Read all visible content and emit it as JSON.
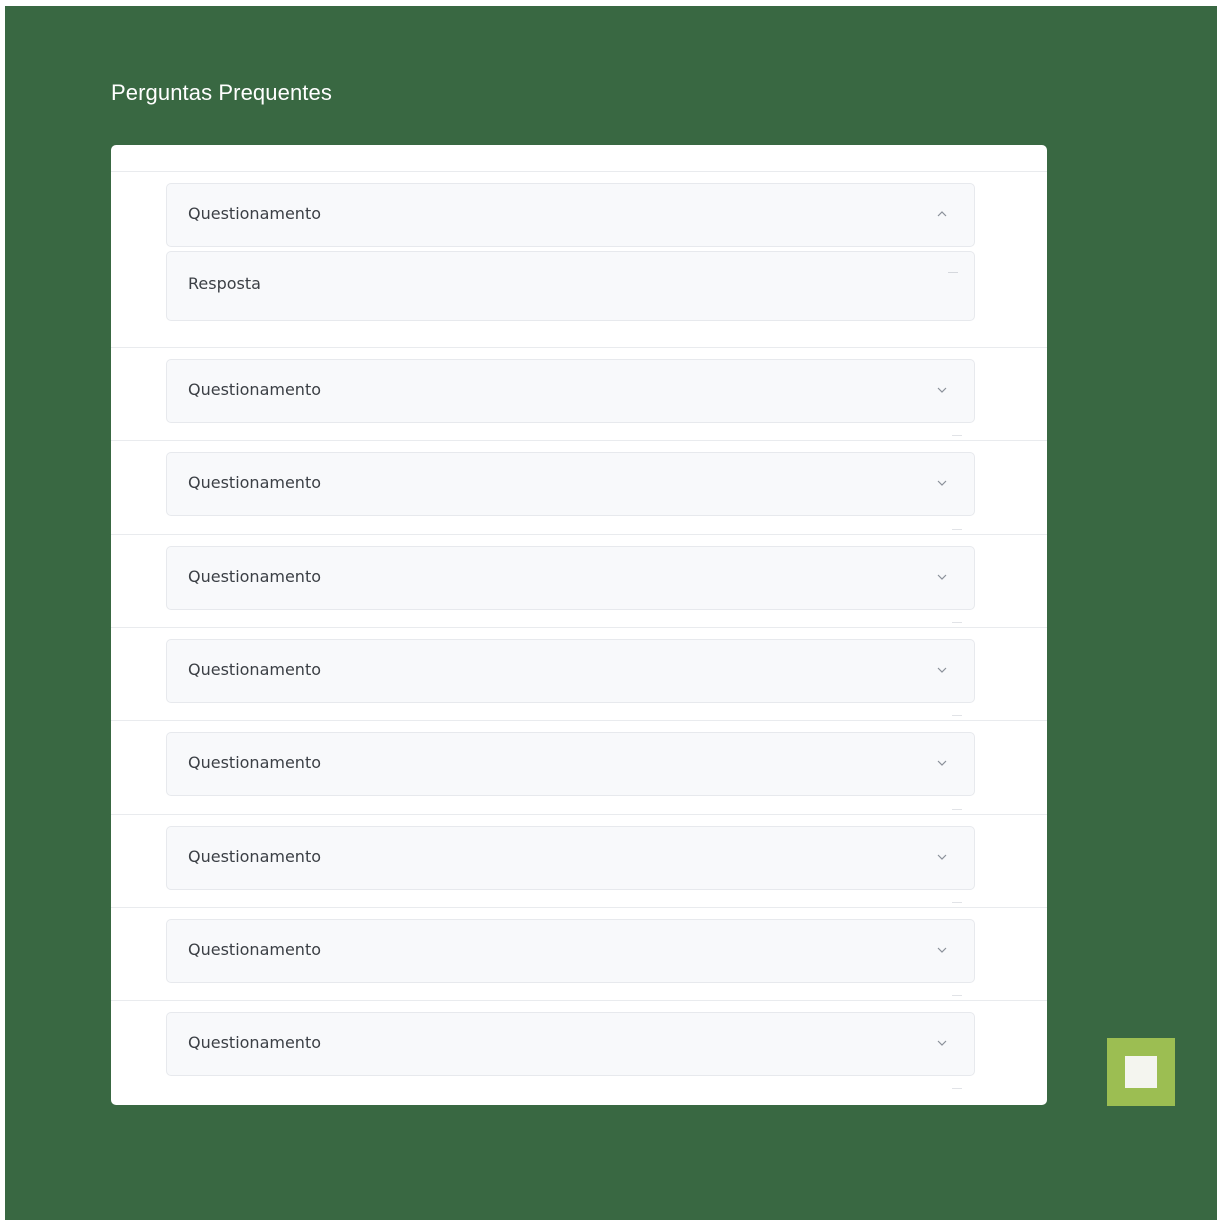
{
  "faq": {
    "title": "Perguntas Prequentes",
    "items": [
      {
        "question": "Questionamento",
        "answer": "Resposta",
        "expanded": true
      },
      {
        "question": "Questionamento",
        "expanded": false
      },
      {
        "question": "Questionamento",
        "expanded": false
      },
      {
        "question": "Questionamento",
        "expanded": false
      },
      {
        "question": "Questionamento",
        "expanded": false
      },
      {
        "question": "Questionamento",
        "expanded": false
      },
      {
        "question": "Questionamento",
        "expanded": false
      },
      {
        "question": "Questionamento",
        "expanded": false
      },
      {
        "question": "Questionamento",
        "expanded": false
      }
    ]
  },
  "colors": {
    "background": "#396842",
    "card": "#ffffff",
    "accordion": "#f8f9fb",
    "scroll_button": "#9cbe52"
  },
  "icons": {
    "expanded": "chevron-up-icon",
    "collapsed": "chevron-down-icon",
    "scroll_button": "scroll-to-top-icon"
  }
}
